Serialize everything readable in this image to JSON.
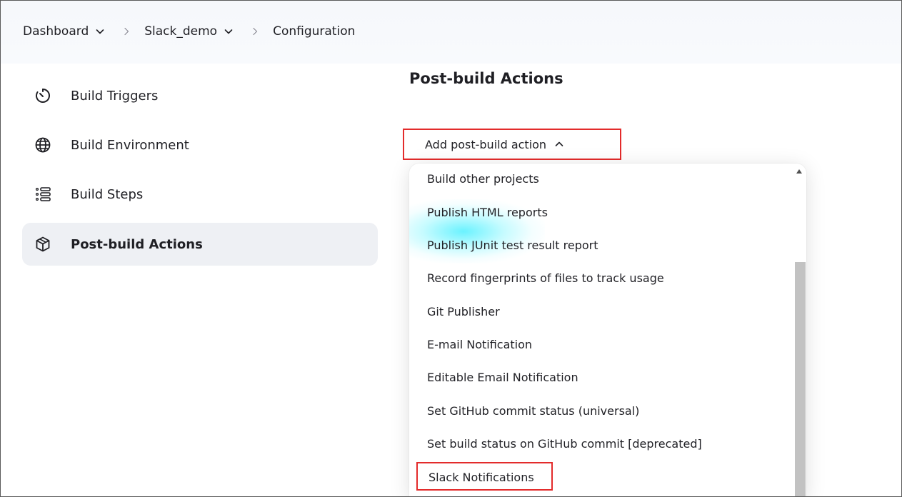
{
  "breadcrumb": {
    "items": [
      {
        "label": "Dashboard"
      },
      {
        "label": "Slack_demo"
      },
      {
        "label": "Configuration"
      }
    ]
  },
  "sidebar": {
    "items": [
      {
        "label": "Build Triggers",
        "icon": "timer-icon"
      },
      {
        "label": "Build Environment",
        "icon": "globe-icon"
      },
      {
        "label": "Build Steps",
        "icon": "list-steps-icon"
      },
      {
        "label": "Post-build Actions",
        "icon": "package-icon",
        "active": true
      }
    ]
  },
  "main": {
    "section_title": "Post-build Actions",
    "add_button_label": "Add post-build action"
  },
  "dropdown": {
    "items": [
      "Build other projects",
      "Publish HTML reports",
      "Publish JUnit test result report",
      "Record fingerprints of files to track usage",
      "Git Publisher",
      "E-mail Notification",
      "Editable Email Notification",
      "Set GitHub commit status (universal)",
      "Set build status on GitHub commit [deprecated]",
      "Slack Notifications"
    ],
    "highlighted_item": "Slack Notifications"
  },
  "colors": {
    "highlight_border": "#e32b2b",
    "active_sidebar_bg": "#eef0f4",
    "breadcrumb_bg": "#f6f8fb"
  }
}
